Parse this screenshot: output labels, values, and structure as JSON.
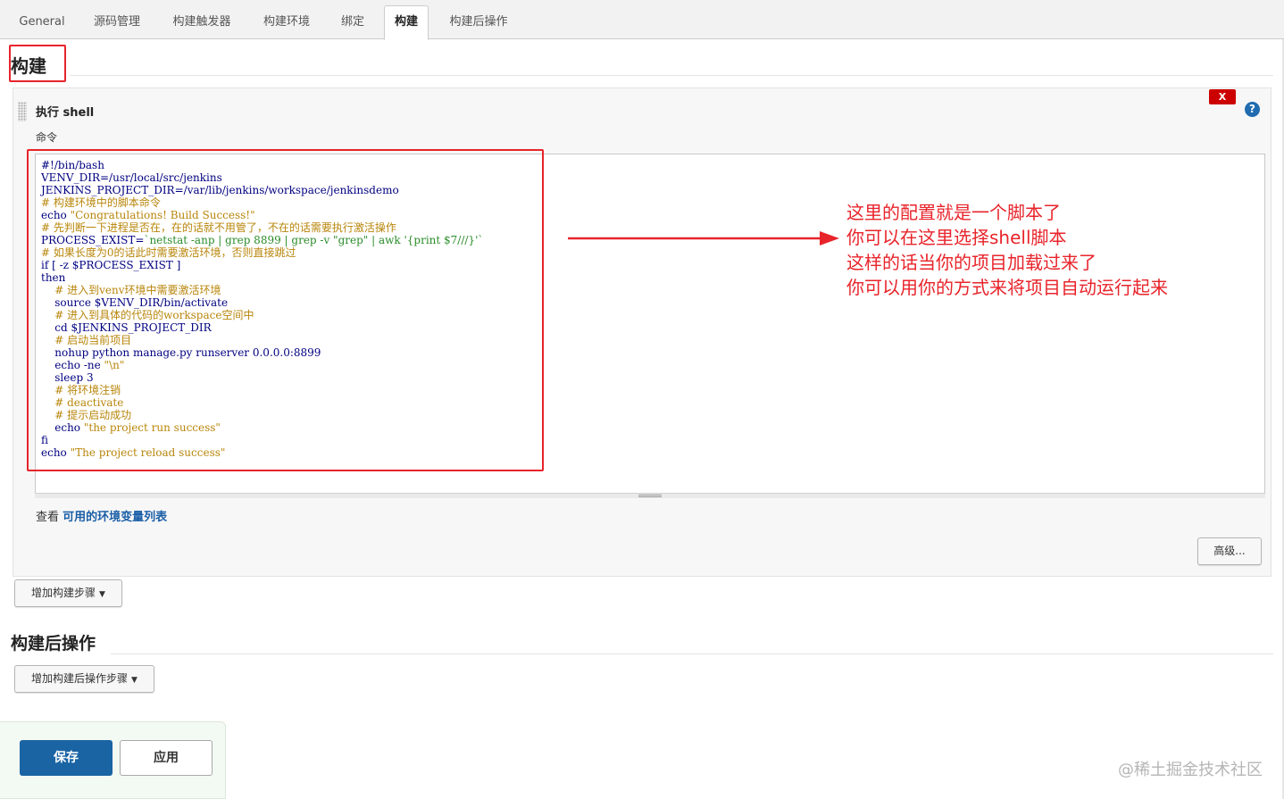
{
  "tabs": [
    {
      "label": "General"
    },
    {
      "label": "源码管理"
    },
    {
      "label": "构建触发器"
    },
    {
      "label": "构建环境"
    },
    {
      "label": "绑定"
    },
    {
      "label": "构建"
    },
    {
      "label": "构建后操作"
    }
  ],
  "active_tab": "构建",
  "build_section": {
    "title": "构建",
    "step": {
      "title": "执行 shell",
      "delete_label": "X",
      "help_label": "?",
      "command_label": "命令",
      "code_lines": [
        {
          "parts": [
            {
              "t": "#!/bin/bash",
              "c": "kw"
            }
          ]
        },
        {
          "parts": [
            {
              "t": "VENV_DIR=/usr/local/src/jenkins",
              "c": "kw"
            }
          ]
        },
        {
          "parts": [
            {
              "t": "JENKINS_PROJECT_DIR=/var/lib/jenkins/workspace/jenkinsdemo",
              "c": "kw"
            }
          ]
        },
        {
          "parts": [
            {
              "t": "# 构建环境中的脚本命令",
              "c": "com"
            }
          ]
        },
        {
          "parts": [
            {
              "t": "echo ",
              "c": "kw"
            },
            {
              "t": "\"Congratulations! Build Success!\"",
              "c": "str"
            }
          ]
        },
        {
          "parts": [
            {
              "t": "# 先判断一下进程是否在，在的话就不用管了，不在的话需要执行激活操作",
              "c": "com"
            }
          ]
        },
        {
          "parts": [
            {
              "t": "PROCESS_EXIST=",
              "c": "kw"
            },
            {
              "t": "`netstat -anp | grep 8899 | grep -v \"grep\" | awk '{print $7///}'`",
              "c": "green"
            }
          ]
        },
        {
          "parts": [
            {
              "t": "# 如果长度为0的话此时需要激活环境，否则直接跳过",
              "c": "com"
            }
          ]
        },
        {
          "parts": [
            {
              "t": "if [ -z $PROCESS_EXIST ]",
              "c": "kw"
            }
          ]
        },
        {
          "parts": [
            {
              "t": "then",
              "c": "kw"
            }
          ]
        },
        {
          "parts": [
            {
              "t": "    # 进入到venv环境中需要激活环境",
              "c": "com"
            }
          ]
        },
        {
          "parts": [
            {
              "t": "    source $VENV_DIR/bin/activate",
              "c": "kw"
            }
          ]
        },
        {
          "parts": [
            {
              "t": "    # 进入到具体的代码的workspace空间中",
              "c": "com"
            }
          ]
        },
        {
          "parts": [
            {
              "t": "    cd $JENKINS_PROJECT_DIR",
              "c": "kw"
            }
          ]
        },
        {
          "parts": [
            {
              "t": "    # 启动当前项目",
              "c": "com"
            }
          ]
        },
        {
          "parts": [
            {
              "t": "    nohup python manage.py runserver 0.0.0.0:8899",
              "c": "kw"
            }
          ]
        },
        {
          "parts": [
            {
              "t": "    echo -ne ",
              "c": "kw"
            },
            {
              "t": "\"\\n\"",
              "c": "str"
            }
          ]
        },
        {
          "parts": [
            {
              "t": "    sleep 3",
              "c": "kw"
            }
          ]
        },
        {
          "parts": [
            {
              "t": "    # 将环境注销",
              "c": "com"
            }
          ]
        },
        {
          "parts": [
            {
              "t": "    # deactivate",
              "c": "com"
            }
          ]
        },
        {
          "parts": [
            {
              "t": "    # 提示启动成功",
              "c": "com"
            }
          ]
        },
        {
          "parts": [
            {
              "t": "    echo ",
              "c": "kw"
            },
            {
              "t": "\"the project run success\"",
              "c": "str"
            }
          ]
        },
        {
          "parts": [
            {
              "t": "fi",
              "c": "kw"
            }
          ]
        },
        {
          "parts": [
            {
              "t": "echo ",
              "c": "kw"
            },
            {
              "t": "\"The project reload success\"",
              "c": "str"
            }
          ]
        }
      ],
      "env_prefix": "查看 ",
      "env_link": "可用的环境变量列表",
      "advanced_label": "高级..."
    },
    "add_step_label": "增加构建步骤"
  },
  "post_build_section": {
    "title": "构建后操作",
    "add_step_label": "增加构建后操作步骤"
  },
  "annotation_lines": [
    "这里的配置就是一个脚本了",
    "你可以在这里选择shell脚本",
    "这样的话当你的项目加载过来了",
    "你可以用你的方式来将项目自动运行起来"
  ],
  "footer": {
    "save_label": "保存",
    "apply_label": "应用"
  },
  "watermark": "@稀土掘金技术社区",
  "colors": {
    "accent_red": "#e8242b",
    "primary_blue": "#1a64a4",
    "link_blue": "#1a5ea6"
  }
}
